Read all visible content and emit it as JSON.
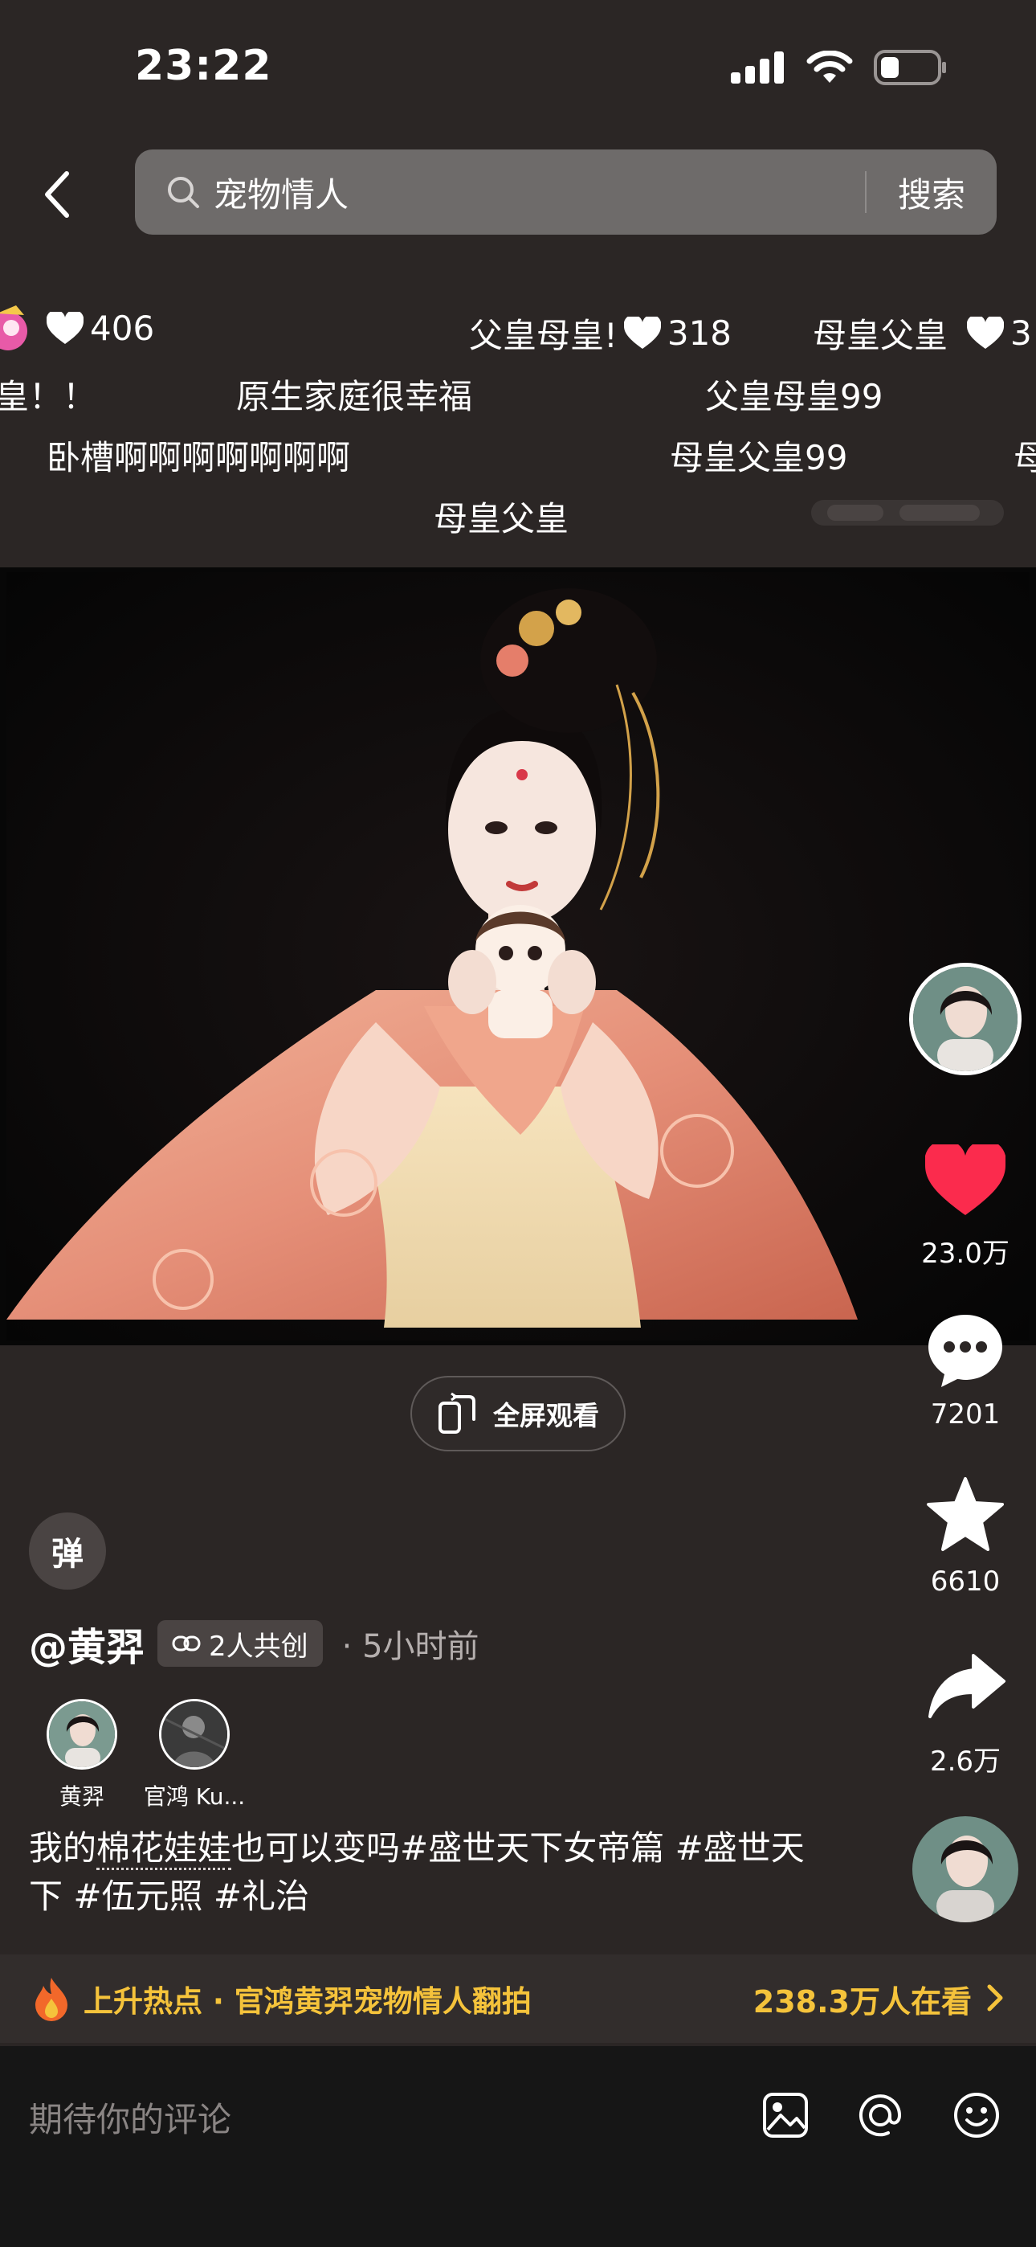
{
  "status_bar": {
    "time": "23:22"
  },
  "search": {
    "query": "宠物情人",
    "button_label": "搜索"
  },
  "danmaku": [
    {
      "text": "",
      "likes": "406"
    },
    {
      "text": "父皇母皇!",
      "likes": "318"
    },
    {
      "text": "母皇父皇",
      "likes": "3"
    },
    {
      "text": "皇！！"
    },
    {
      "text": "原生家庭很幸福"
    },
    {
      "text": "父皇母皇99"
    },
    {
      "text": "卧槽啊啊啊啊啊啊啊"
    },
    {
      "text": "母皇父皇99"
    },
    {
      "text": "母"
    },
    {
      "text": "母皇父皇"
    }
  ],
  "actions": {
    "likes": "23.0万",
    "comments": "7201",
    "favorites": "6610",
    "shares": "2.6万"
  },
  "player": {
    "fullscreen_label": "全屏观看",
    "danmaku_toggle": "弹"
  },
  "post": {
    "author": "@黄羿",
    "cocreate_label": "2人共创",
    "time": "· 5小时前",
    "creators": [
      {
        "name": "黄羿"
      },
      {
        "name": "官鸿 Ku..."
      }
    ],
    "caption_prefix": "我的",
    "caption_highlight": "棉花娃娃",
    "caption_rest": "也可以变吗#盛世天下女帝篇 #盛世天下 #伍元照 #礼治"
  },
  "hot_topic": {
    "text": "上升热点 · 官鸿黄羿宠物情人翻拍",
    "viewers": "238.3万人在看"
  },
  "comment_bar": {
    "placeholder": "期待你的评论"
  },
  "colors": {
    "like_red": "#fb2b4d",
    "hot_yellow": "#f5c33b",
    "background": "#2b2625"
  }
}
